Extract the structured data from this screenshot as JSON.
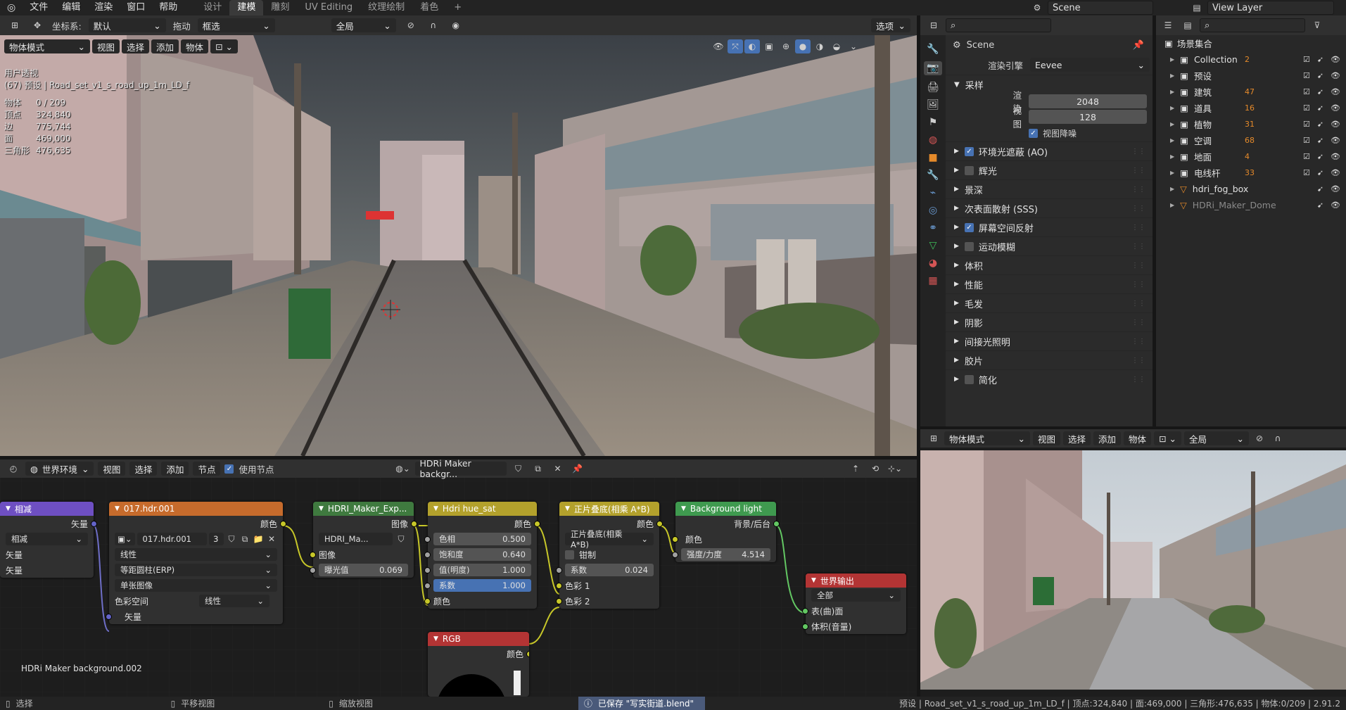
{
  "topbar": {
    "menus": [
      "文件",
      "编辑",
      "渲染",
      "窗口",
      "帮助"
    ],
    "tabs": [
      "设计",
      "建模",
      "雕刻",
      "UV Editing",
      "纹理绘制",
      "着色"
    ],
    "active_tab": "建模",
    "scene": "Scene",
    "view_layer": "View Layer"
  },
  "toolbar": {
    "coord_label": "坐标系:",
    "coord_value": "默认",
    "drag_label": "拖动",
    "select_value": "框选",
    "global_value": "全局",
    "options_label": "选项"
  },
  "viewport": {
    "mode": "物体模式",
    "menus": [
      "视图",
      "选择",
      "添加",
      "物体"
    ],
    "perspective": "用户透视",
    "object_info": "(67) 预设 | Road_set_v1_s_road_up_1m_LD_f",
    "stats": [
      {
        "label": "物体",
        "value": "0 / 209"
      },
      {
        "label": "顶点",
        "value": "324,840"
      },
      {
        "label": "边",
        "value": "775,744"
      },
      {
        "label": "面",
        "value": "469,000"
      },
      {
        "label": "三角形",
        "value": "476,635"
      }
    ]
  },
  "properties": {
    "scene_name": "Scene",
    "render_engine_label": "渲染引擎",
    "render_engine": "Eevee",
    "sampling_label": "采样",
    "render_label": "渲染",
    "render_samples": "2048",
    "viewport_label": "视图",
    "viewport_samples": "128",
    "denoise_label": "视图降噪",
    "sections": [
      {
        "label": "环境光遮蔽 (AO)",
        "checkbox": true,
        "checked": true
      },
      {
        "label": "辉光",
        "checkbox": true,
        "checked": false
      },
      {
        "label": "景深",
        "checkbox": false,
        "checked": false
      },
      {
        "label": "次表面散射 (SSS)",
        "checkbox": false,
        "checked": false
      },
      {
        "label": "屏幕空间反射",
        "checkbox": true,
        "checked": true
      },
      {
        "label": "运动模糊",
        "checkbox": true,
        "checked": false
      },
      {
        "label": "体积",
        "checkbox": false,
        "checked": false
      },
      {
        "label": "性能",
        "checkbox": false,
        "checked": false
      },
      {
        "label": "毛发",
        "checkbox": false,
        "checked": false
      },
      {
        "label": "阴影",
        "checkbox": false,
        "checked": false
      },
      {
        "label": "间接光照明",
        "checkbox": false,
        "checked": false
      },
      {
        "label": "胶片",
        "checkbox": false,
        "checked": false
      },
      {
        "label": "简化",
        "checkbox": true,
        "checked": false
      }
    ]
  },
  "outliner": {
    "root": "场景集合",
    "items": [
      {
        "name": "Collection",
        "count": "2"
      },
      {
        "name": "预设",
        "count": ""
      },
      {
        "name": "建筑",
        "count": "47"
      },
      {
        "name": "道具",
        "count": "16"
      },
      {
        "name": "植物",
        "count": "31"
      },
      {
        "name": "空调",
        "count": "68"
      },
      {
        "name": "地面",
        "count": "4"
      },
      {
        "name": "电线杆",
        "count": "33"
      },
      {
        "name": "hdri_fog_box",
        "count": ""
      },
      {
        "name": "HDRi_Maker_Dome",
        "count": ""
      }
    ]
  },
  "node_editor": {
    "world_label": "世界环境",
    "menus": [
      "视图",
      "选择",
      "添加",
      "节点"
    ],
    "use_nodes_label": "使用节点",
    "datablock": "HDRi Maker backgr...",
    "tree_name": "HDRi Maker background.002",
    "nodes": {
      "sub": {
        "title": "相减",
        "out": "矢量",
        "mode": "相减",
        "in1": "矢量",
        "in2": "矢量"
      },
      "hdr": {
        "title": "017.hdr.001",
        "out": "颜色",
        "image": "017.hdr.001",
        "users": "3",
        "interp": "线性",
        "proj": "等距圆柱(ERP)",
        "src": "单张图像",
        "cs_label": "色彩空间",
        "cs": "线性",
        "vec": "矢量"
      },
      "exp": {
        "title": "HDRI_Maker_Exp...",
        "out": "图像",
        "group": "HDRI_Ma...",
        "in": "图像",
        "exposure_label": "曝光值",
        "exposure": "0.069"
      },
      "hue": {
        "title": "Hdri hue_sat",
        "out": "颜色",
        "hue_label": "色相",
        "hue": "0.500",
        "sat_label": "饱和度",
        "sat": "0.640",
        "val_label": "值(明度)",
        "val": "1.000",
        "fac_label": "系数",
        "fac": "1.000",
        "in": "颜色"
      },
      "mix": {
        "title": "正片叠底(相乘 A*B)",
        "out": "颜色",
        "mode": "正片叠底(相乘 A*B)",
        "clamp": "钳制",
        "fac_label": "系数",
        "fac": "0.024",
        "c1": "色彩 1",
        "c2": "色彩 2"
      },
      "bg": {
        "title": "Background light",
        "out": "背景/后台",
        "color": "颜色",
        "strength_label": "强度/力度",
        "strength": "4.514"
      },
      "world": {
        "title": "世界输出",
        "target": "全部",
        "surface": "表(曲)面",
        "volume": "体积(音量)"
      },
      "rgb": {
        "title": "RGB",
        "out": "颜色"
      }
    }
  },
  "preview": {
    "mode": "物体模式",
    "menus": [
      "视图",
      "选择",
      "添加",
      "物体"
    ],
    "global": "全局"
  },
  "status": {
    "select": "选择",
    "pan": "平移视图",
    "zoom": "缩放视图",
    "saved": "已保存 \"写实街道.blend\"",
    "info": "预设 | Road_set_v1_s_road_up_1m_LD_f | 顶点:324,840 | 面:469,000 | 三角形:476,635 | 物体:0/209 | 2.91.2"
  },
  "colors": {
    "accent": "#4772b3",
    "node_vector": "#6e4fc2",
    "node_texture": "#c66b2c",
    "node_group": "#3f7a3f",
    "node_color": "#b3a12c",
    "node_shader": "#3f9a4f",
    "node_output": "#b33434",
    "node_input": "#b33434"
  }
}
